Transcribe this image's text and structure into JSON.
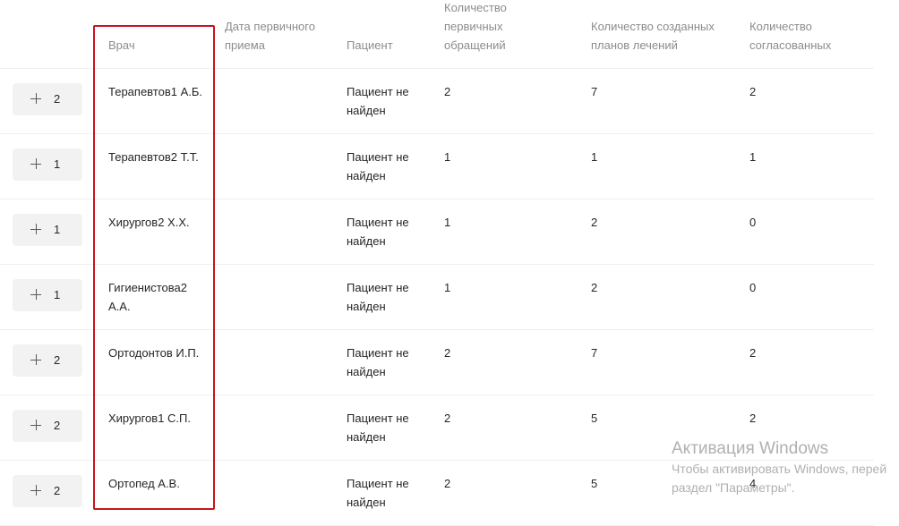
{
  "table": {
    "headers": {
      "doctor": "Врач",
      "first_visit_date": "Дата первичного\nприема",
      "patient": "Пациент",
      "primary_visits": "Количество\nпервичных\nобращений",
      "created_plans": "Количество созданных\nпланов лечений",
      "agreed": "Количество\nсогласованных"
    },
    "rows": [
      {
        "count": "2",
        "doctor": "Терапевтов1 А.Б.",
        "first_visit_date": "",
        "patient": "Пациент не найден",
        "primary_visits": "2",
        "created_plans": "7",
        "agreed": "2"
      },
      {
        "count": "1",
        "doctor": "Терапевтов2 Т.Т.",
        "first_visit_date": "",
        "patient": "Пациент не найден",
        "primary_visits": "1",
        "created_plans": "1",
        "agreed": "1"
      },
      {
        "count": "1",
        "doctor": "Хирургов2 Х.Х.",
        "first_visit_date": "",
        "patient": "Пациент не найден",
        "primary_visits": "1",
        "created_plans": "2",
        "agreed": "0"
      },
      {
        "count": "1",
        "doctor": "Гигиенистова2 А.А.",
        "first_visit_date": "",
        "patient": "Пациент не найден",
        "primary_visits": "1",
        "created_plans": "2",
        "agreed": "0"
      },
      {
        "count": "2",
        "doctor": "Ортодонтов И.П.",
        "first_visit_date": "",
        "patient": "Пациент не найден",
        "primary_visits": "2",
        "created_plans": "7",
        "agreed": "2"
      },
      {
        "count": "2",
        "doctor": "Хирургов1 С.П.",
        "first_visit_date": "",
        "patient": "Пациент не найден",
        "primary_visits": "2",
        "created_plans": "5",
        "agreed": "2"
      },
      {
        "count": "2",
        "doctor": "Ортопед А.В.",
        "first_visit_date": "",
        "patient": "Пациент не найден",
        "primary_visits": "2",
        "created_plans": "5",
        "agreed": "4"
      }
    ]
  },
  "watermark": {
    "title": "Активация Windows",
    "line1": "Чтобы активировать Windows, перей",
    "line2": "раздел \"Параметры\"."
  },
  "colors": {
    "highlight": "#c8141e",
    "header_text": "#8c8c8c",
    "button_bg": "#f2f2f2"
  }
}
